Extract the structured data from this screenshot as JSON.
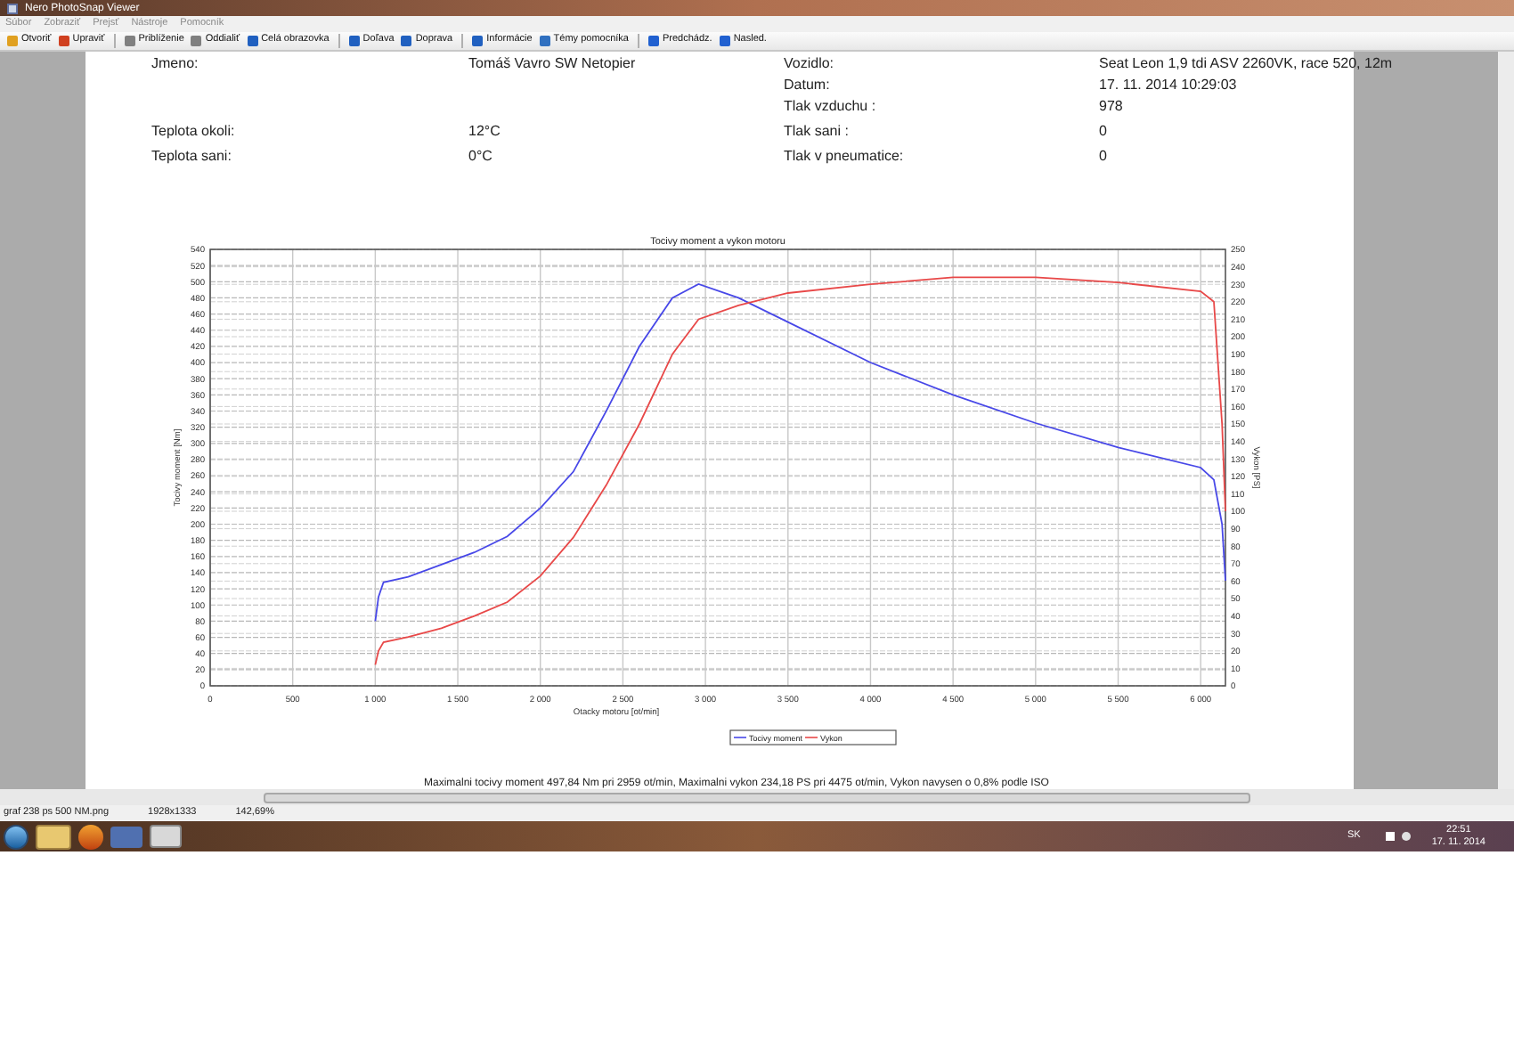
{
  "window": {
    "title": "Nero PhotoSnap Viewer"
  },
  "menu": [
    "Súbor",
    "Zobraziť",
    "Prejsť",
    "Nástroje",
    "Pomocník"
  ],
  "toolbar": [
    [
      "Otvoriť",
      "Upraviť"
    ],
    [
      "Priblíženie",
      "Oddialiť",
      "Celá obrazovka"
    ],
    [
      "Doľava",
      "Doprava"
    ],
    [
      "Informácie",
      "Témy pomocníka"
    ],
    [
      "Predchádz.",
      "Nasled."
    ]
  ],
  "document": {
    "info_rows": [
      {
        "left": {
          "label": "Jmeno:",
          "value": "Tomáš Vavro SW Netopier"
        },
        "right": {
          "label": "Vozidlo:",
          "value": "Seat Leon 1,9 tdi ASV 2260VK, race 520, 12m"
        }
      },
      {
        "right": {
          "label": "Datum:",
          "value": "17. 11. 2014 10:29:03"
        }
      },
      {
        "right": {
          "label": "Tlak vzduchu :",
          "value": "978"
        }
      },
      {
        "left": {
          "label": "Teplota okoli:",
          "value": "12°C"
        },
        "right": {
          "label": "Tlak sani :",
          "value": "0"
        }
      },
      {
        "left": {
          "label": "Teplota sani:",
          "value": "0°C"
        },
        "right": {
          "label": "Tlak v pneumatice:",
          "value": "0"
        }
      }
    ],
    "chart_data": {
      "type": "line",
      "title": "Tocivy moment a vykon motoru",
      "xlabel": "Otacky motoru [ot/min]",
      "ylabel": "Tocivy moment [Nm]",
      "y2label": "Vykon [PS]",
      "x": [
        1000,
        1020,
        1050,
        1200,
        1400,
        1600,
        1800,
        2000,
        2200,
        2400,
        2600,
        2800,
        2959,
        3200,
        3500,
        4000,
        4500,
        5000,
        5500,
        6000,
        6080,
        6130,
        6150
      ],
      "series": [
        {
          "name": "Tocivy moment",
          "color": "#4848e8",
          "values": [
            80,
            110,
            128,
            135,
            150,
            165,
            185,
            220,
            265,
            340,
            420,
            480,
            497,
            480,
            450,
            400,
            360,
            325,
            295,
            270,
            255,
            200,
            130
          ]
        },
        {
          "name": "Vykon",
          "color": "#e84848",
          "axis": "y2",
          "values": [
            12,
            20,
            25,
            28,
            33,
            40,
            48,
            63,
            85,
            115,
            150,
            190,
            210,
            218,
            225,
            230,
            234,
            234,
            231,
            226,
            220,
            150,
            100
          ]
        }
      ],
      "grid": true,
      "legend": "bottom",
      "xlim": [
        0,
        6150
      ],
      "ylim": [
        0,
        540
      ],
      "y2lim": [
        0,
        250
      ],
      "xticks": [
        {
          "value": 0,
          "label": "0"
        },
        {
          "value": 500,
          "label": "500"
        },
        {
          "value": 1000,
          "label": "1 000"
        },
        {
          "value": 1500,
          "label": "1 500"
        },
        {
          "value": 2000,
          "label": "2 000"
        },
        {
          "value": 2500,
          "label": "2 500"
        },
        {
          "value": 3000,
          "label": "3 000"
        },
        {
          "value": 3500,
          "label": "3 500"
        },
        {
          "value": 4000,
          "label": "4 000"
        },
        {
          "value": 4500,
          "label": "4 500"
        },
        {
          "value": 5000,
          "label": "5 000"
        },
        {
          "value": 5500,
          "label": "5 500"
        },
        {
          "value": 6000,
          "label": "6 000"
        }
      ],
      "yticks": [
        0,
        20,
        40,
        60,
        80,
        100,
        120,
        140,
        160,
        180,
        200,
        220,
        240,
        260,
        280,
        300,
        320,
        340,
        360,
        380,
        400,
        420,
        440,
        460,
        480,
        500,
        520,
        540
      ],
      "y2ticks": [
        0,
        10,
        20,
        30,
        40,
        50,
        60,
        70,
        80,
        90,
        100,
        110,
        120,
        130,
        140,
        150,
        160,
        170,
        180,
        190,
        200,
        210,
        220,
        230,
        240,
        250
      ]
    },
    "summary": "Maximalni tocivy moment 497,84 Nm pri 2959 ot/min,  Maximalni vykon 234,18 PS pri 4475 ot/min,  Vykon navysen o 0,8% podle ISO"
  },
  "status_bar": [
    "graf 238 ps 500 NM.png",
    "1928x1333",
    "142,69%"
  ],
  "taskbar": {
    "language": "SK",
    "time": "22:51",
    "date": "17. 11. 2014"
  }
}
